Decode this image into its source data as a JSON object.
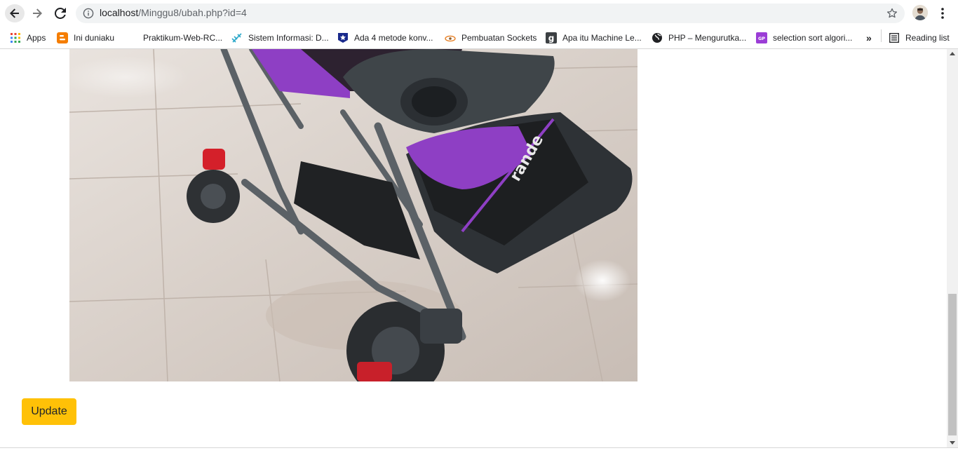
{
  "browser": {
    "url_host": "localhost",
    "url_path": "/Minggu8/ubah.php?id=4",
    "bookmarks": [
      {
        "label": "Apps",
        "icon": "apps-grid-icon"
      },
      {
        "label": "Ini duniaku",
        "icon": "blogger-icon"
      },
      {
        "label": "Praktikum-Web-RC...",
        "icon": "blank-page-icon"
      },
      {
        "label": "Sistem Informasi: D...",
        "icon": "sparkle-icon"
      },
      {
        "label": "Ada 4 metode konv...",
        "icon": "star-shield-icon"
      },
      {
        "label": "Pembuatan Sockets",
        "icon": "eye-icon"
      },
      {
        "label": "Apa itu Machine Le...",
        "icon": "g-letter-icon"
      },
      {
        "label": "PHP – Mengurutka...",
        "icon": "globe-icon"
      },
      {
        "label": "selection sort algori...",
        "icon": "gp-icon"
      }
    ],
    "overflow": "»",
    "reading_list": "Reading list"
  },
  "page": {
    "update_label": "Update",
    "photo_brand": "rande"
  },
  "colors": {
    "update_button": "#ffc107",
    "stroller_purple": "#8e3fc4",
    "stroller_frame": "#3a3f44"
  }
}
